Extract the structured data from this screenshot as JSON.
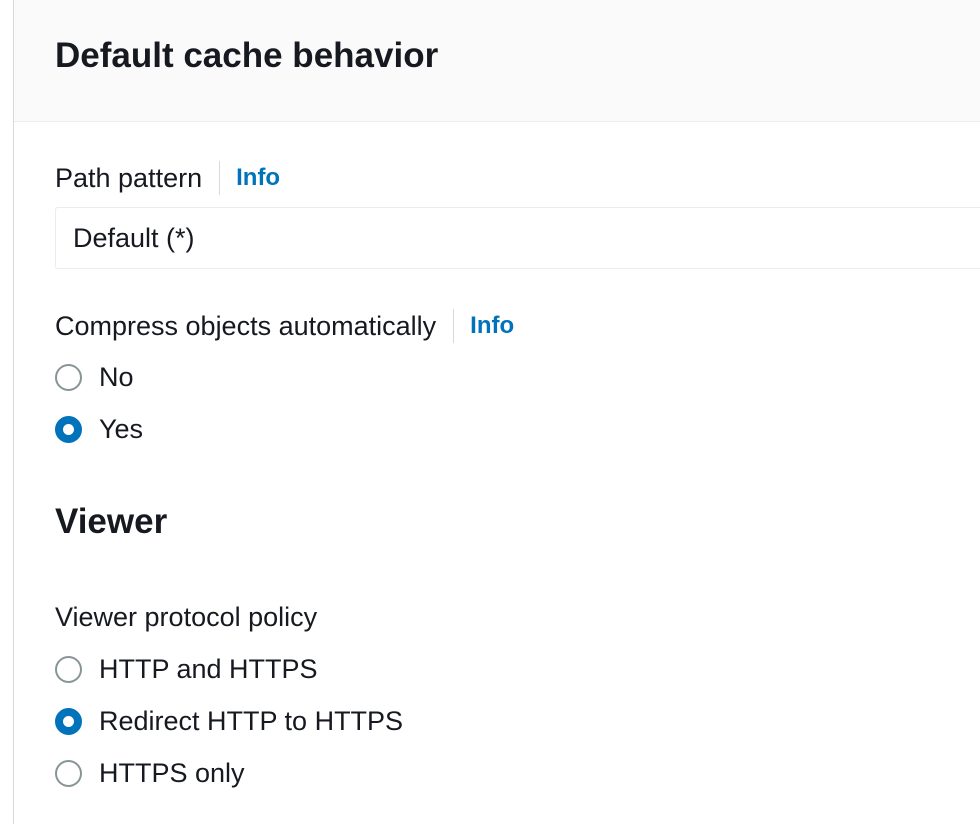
{
  "panel": {
    "title": "Default cache behavior"
  },
  "path_pattern": {
    "label": "Path pattern",
    "info_link": "Info",
    "value": "Default (*)"
  },
  "compress": {
    "label": "Compress objects automatically",
    "info_link": "Info",
    "options": [
      {
        "label": "No",
        "selected": false
      },
      {
        "label": "Yes",
        "selected": true
      }
    ]
  },
  "viewer": {
    "heading": "Viewer",
    "protocol_policy": {
      "label": "Viewer protocol policy",
      "options": [
        {
          "label": "HTTP and HTTPS",
          "selected": false
        },
        {
          "label": "Redirect HTTP to HTTPS",
          "selected": true
        },
        {
          "label": "HTTPS only",
          "selected": false
        }
      ]
    }
  },
  "colors": {
    "accent": "#0073bb",
    "header_background": "#fafafa",
    "text": "#16191f"
  }
}
